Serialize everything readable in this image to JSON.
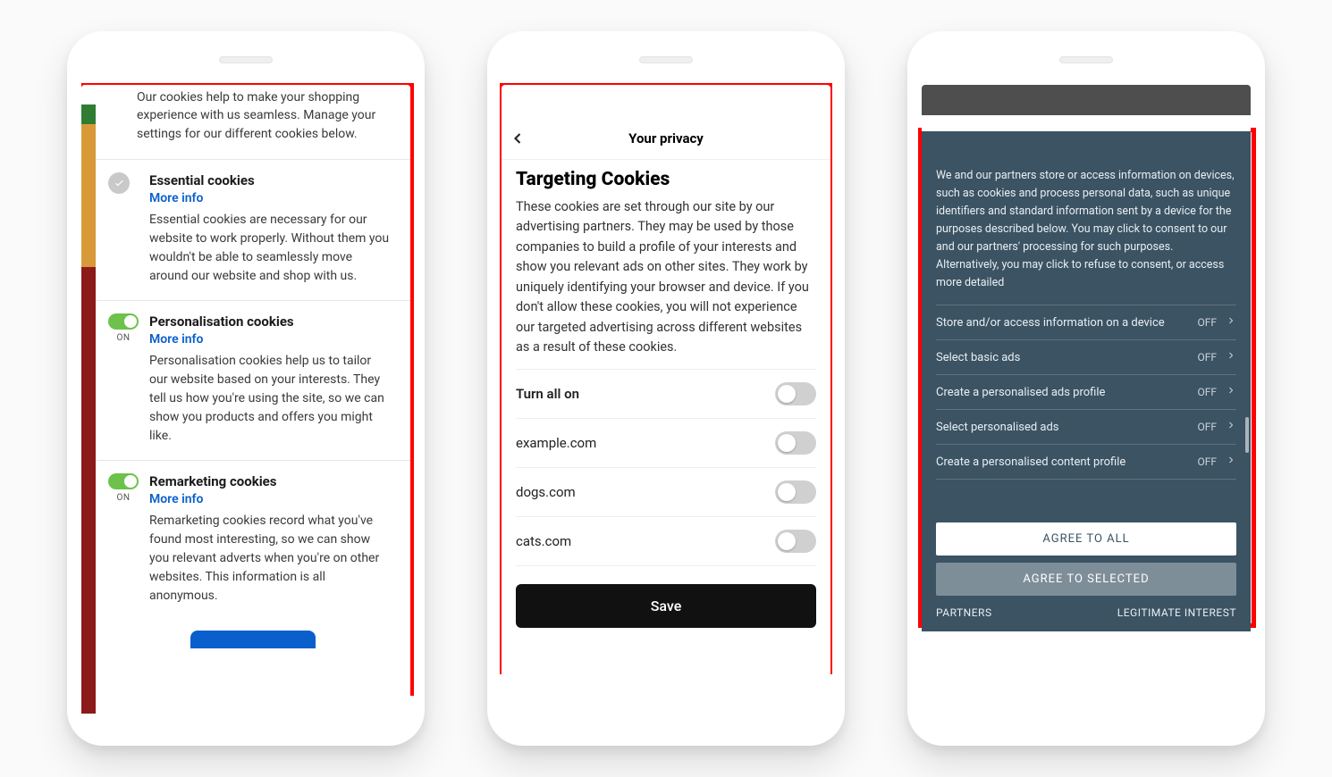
{
  "phone1": {
    "intro": "Our cookies help to make your shopping experience with us seamless. Manage your settings for our different cookies below.",
    "sections": [
      {
        "title": "Essential cookies",
        "more": "More info",
        "desc": "Essential cookies are necessary for our website to work properly. Without them you wouldn't be able to seamlessly move around our website and shop with us."
      },
      {
        "title": "Personalisation cookies",
        "on": "ON",
        "more": "More info",
        "desc": "Personalisation cookies help us to tailor our website based on your interests. They tell us how you're using the site, so we can show you products and offers you might like."
      },
      {
        "title": "Remarketing cookies",
        "on": "ON",
        "more": "More info",
        "desc": "Remarketing cookies record what you've found most interesting, so we can show you relevant adverts when you're on other websites. This information is all anonymous."
      }
    ]
  },
  "phone2": {
    "header": "Your privacy",
    "heading": "Targeting Cookies",
    "desc": "These cookies are set through our site by our advertising partners. They may be used by those companies to build a profile of your interests and show you relevant ads on other sites. They work by uniquely identifying your browser and device. If you don't allow these cookies, you will not experience our targeted advertising across different websites as a result of these cookies.",
    "all": "Turn all on",
    "rows": [
      "example.com",
      "dogs.com",
      "cats.com"
    ],
    "save": "Save"
  },
  "phone3": {
    "intro": "We and our partners store or access information on devices, such as cookies and process personal data, such as unique identifiers and standard information sent by a device for the purposes described below. You may click to consent to our and our partners' processing for such purposes. Alternatively, you may click to refuse to consent, or access more detailed",
    "off": "OFF",
    "items": [
      "Store and/or access information on a device",
      "Select basic ads",
      "Create a personalised ads profile",
      "Select personalised ads",
      "Create a personalised content profile"
    ],
    "agree_all": "AGREE TO ALL",
    "agree_sel": "AGREE TO SELECTED",
    "partners": "PARTNERS",
    "legit": "LEGITIMATE INTEREST"
  }
}
